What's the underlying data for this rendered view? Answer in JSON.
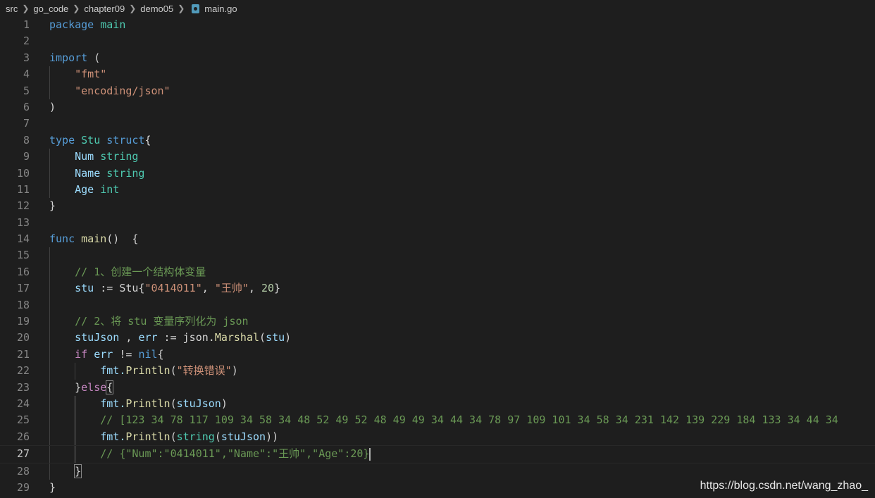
{
  "breadcrumb": {
    "items": [
      "src",
      "go_code",
      "chapter09",
      "demo05"
    ],
    "file": "main.go"
  },
  "code_lines": [
    {
      "n": "1"
    },
    {
      "n": "2"
    },
    {
      "n": "3"
    },
    {
      "n": "4"
    },
    {
      "n": "5"
    },
    {
      "n": "6"
    },
    {
      "n": "7"
    },
    {
      "n": "8"
    },
    {
      "n": "9"
    },
    {
      "n": "10"
    },
    {
      "n": "11"
    },
    {
      "n": "12"
    },
    {
      "n": "13"
    },
    {
      "n": "14"
    },
    {
      "n": "15"
    },
    {
      "n": "16"
    },
    {
      "n": "17"
    },
    {
      "n": "18"
    },
    {
      "n": "19"
    },
    {
      "n": "20"
    },
    {
      "n": "21"
    },
    {
      "n": "22"
    },
    {
      "n": "23"
    },
    {
      "n": "24"
    },
    {
      "n": "25"
    },
    {
      "n": "26"
    },
    {
      "n": "27"
    },
    {
      "n": "28"
    },
    {
      "n": "29"
    }
  ],
  "code": {
    "l1_pkg": "package",
    "l1_main": " main",
    "l3_import": "import",
    "l3_paren": " (",
    "l4_fmt": "\"fmt\"",
    "l5_json": "\"encoding/json\"",
    "l6_close": ")",
    "l8_type": "type",
    "l8_stu": " Stu",
    "l8_struct": " struct",
    "l8_brace": "{",
    "l9_field": "Num",
    "l9_type": " string",
    "l10_field": "Name",
    "l10_type": " string",
    "l11_field": "Age",
    "l11_type": " int",
    "l12_close": "}",
    "l14_func": "func",
    "l14_main": " main",
    "l14_rest": "()  {",
    "l16_comment": "// 1、创建一个结构体变量",
    "l17_a": "stu",
    "l17_b": " := Stu{",
    "l17_s1": "\"0414011\"",
    "l17_c": ", ",
    "l17_s2": "\"王帅\"",
    "l17_d": ", ",
    "l17_n": "20",
    "l17_e": "}",
    "l19_comment": "// 2、将 stu 变量序列化为 json",
    "l20_a": "stuJson",
    "l20_b": " , ",
    "l20_c": "err",
    "l20_d": " := json.",
    "l20_fn": "Marshal",
    "l20_e": "(",
    "l20_f": "stu",
    "l20_g": ")",
    "l21_if": "if",
    "l21_a": " err",
    "l21_b": " != ",
    "l21_nil": "nil",
    "l21_c": "{",
    "l22_a": "fmt.",
    "l22_fn": "Println",
    "l22_b": "(",
    "l22_s": "\"转换错误\"",
    "l22_c": ")",
    "l23_a": "}",
    "l23_else": "else",
    "l23_b": "{",
    "l24_a": "fmt.",
    "l24_fn": "Println",
    "l24_b": "(",
    "l24_v": "stuJson",
    "l24_c": ")",
    "l25_comment": "// [123 34 78 117 109 34 58 34 48 52 49 52 48 49 49 34 44 34 78 97 109 101 34 58 34 231 142 139 229 184 133 34 44 34",
    "l26_a": "fmt.",
    "l26_fn": "Println",
    "l26_b": "(",
    "l26_t": "string",
    "l26_c": "(",
    "l26_v": "stuJson",
    "l26_d": "))",
    "l27_comment": "// {\"Num\":\"0414011\",\"Name\":\"王帅\",\"Age\":20}",
    "l28_close": "}",
    "l29_close": "}"
  },
  "watermark": "https://blog.csdn.net/wang_zhao_",
  "colors": {
    "background": "#1e1e1e",
    "keyword": "#569cd6",
    "control": "#c586c0",
    "string": "#ce9178",
    "type": "#4ec9b0",
    "function": "#dcdcaa",
    "comment": "#6a9955",
    "number": "#b5cea8",
    "variable": "#9cdcfe"
  }
}
